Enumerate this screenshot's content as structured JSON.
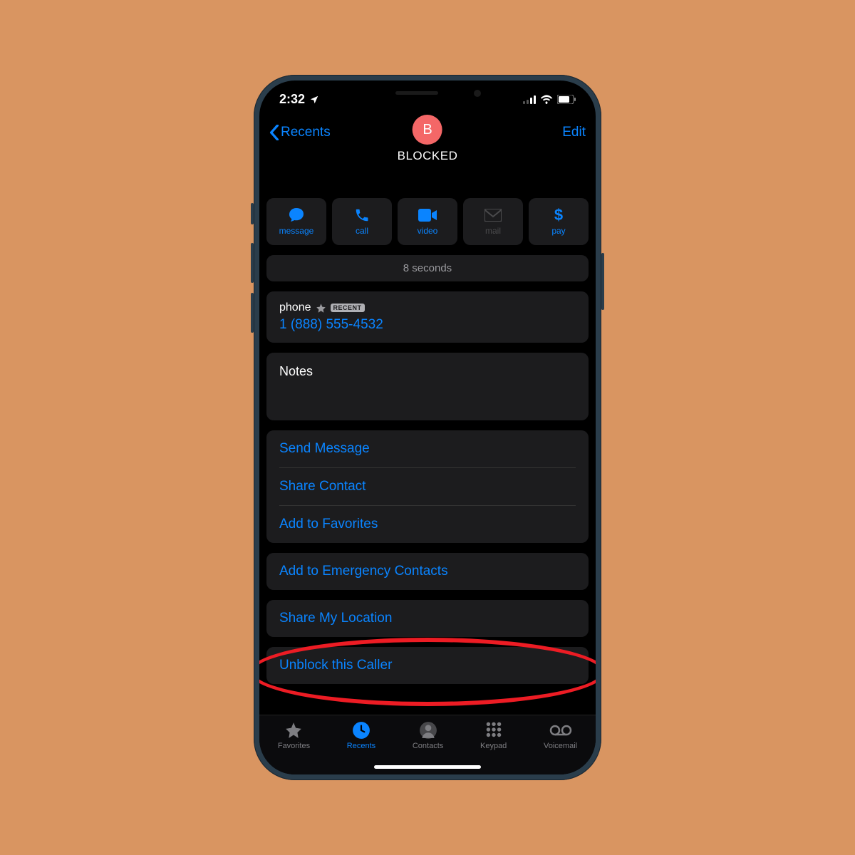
{
  "background_color": "#d99561",
  "status": {
    "time": "2:32"
  },
  "nav": {
    "back_label": "Recents",
    "edit_label": "Edit"
  },
  "contact": {
    "avatar_initial": "B",
    "name": "BLOCKED"
  },
  "quick_actions": {
    "message": "message",
    "call": "call",
    "video": "video",
    "mail": "mail",
    "pay": "pay"
  },
  "call_duration": "8 seconds",
  "phone": {
    "label": "phone",
    "badge": "RECENT",
    "number": "1 (888)  555-4532"
  },
  "notes_label": "Notes",
  "actions": {
    "send_message": "Send Message",
    "share_contact": "Share Contact",
    "add_favorites": "Add to Favorites",
    "emergency": "Add to Emergency Contacts",
    "share_location": "Share My Location",
    "unblock": "Unblock this Caller"
  },
  "tabs": {
    "favorites": "Favorites",
    "recents": "Recents",
    "contacts": "Contacts",
    "keypad": "Keypad",
    "voicemail": "Voicemail"
  }
}
